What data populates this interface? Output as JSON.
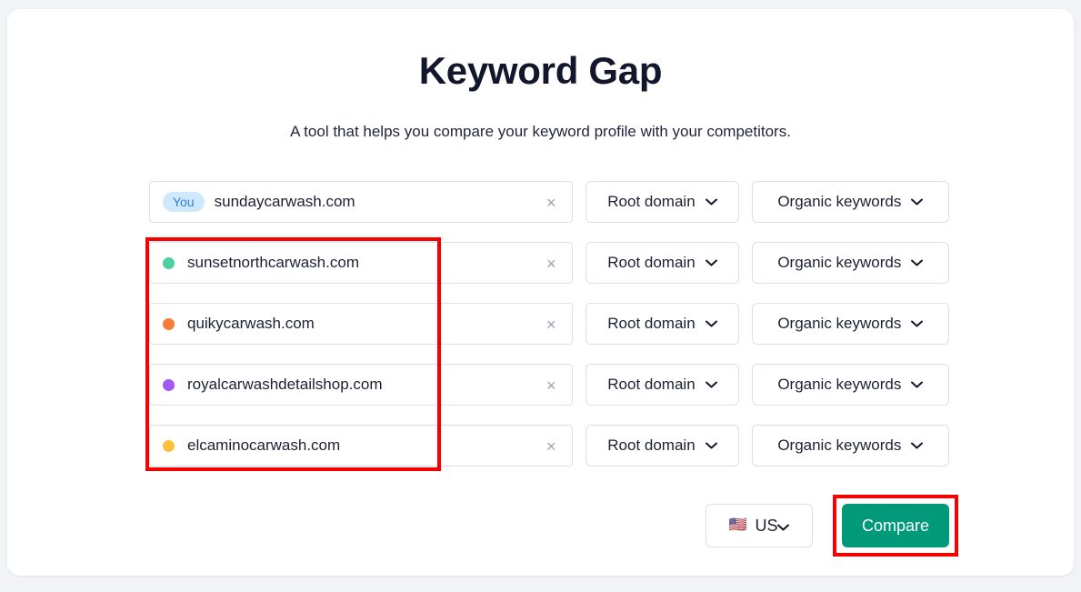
{
  "page": {
    "title": "Keyword Gap",
    "subtitle": "A tool that helps you compare your keyword profile with your competitors."
  },
  "colors": {
    "accent_teal": "#009a7b",
    "annotation_red": "#f90000",
    "badge_bg": "#cfe8fc",
    "badge_text": "#2b7fe0"
  },
  "rows": [
    {
      "badge": "You",
      "dot_color": null,
      "domain": "sundaycarwash.com",
      "clear": "×",
      "scope": "Root domain",
      "type": "Organic keywords"
    },
    {
      "badge": null,
      "dot_color": "#4ecfa0",
      "domain": "sunsetnorthcarwash.com",
      "clear": "×",
      "scope": "Root domain",
      "type": "Organic keywords"
    },
    {
      "badge": null,
      "dot_color": "#f97c38",
      "domain": "quikycarwash.com",
      "clear": "×",
      "scope": "Root domain",
      "type": "Organic keywords"
    },
    {
      "badge": null,
      "dot_color": "#a259f5",
      "domain": "royalcarwashdetailshop.com",
      "clear": "×",
      "scope": "Root domain",
      "type": "Organic keywords"
    },
    {
      "badge": null,
      "dot_color": "#fbc13c",
      "domain": "elcaminocarwash.com",
      "clear": "×",
      "scope": "Root domain",
      "type": "Organic keywords"
    }
  ],
  "footer": {
    "country_flag": "🇺🇸",
    "country_label": "US",
    "compare_label": "Compare"
  }
}
